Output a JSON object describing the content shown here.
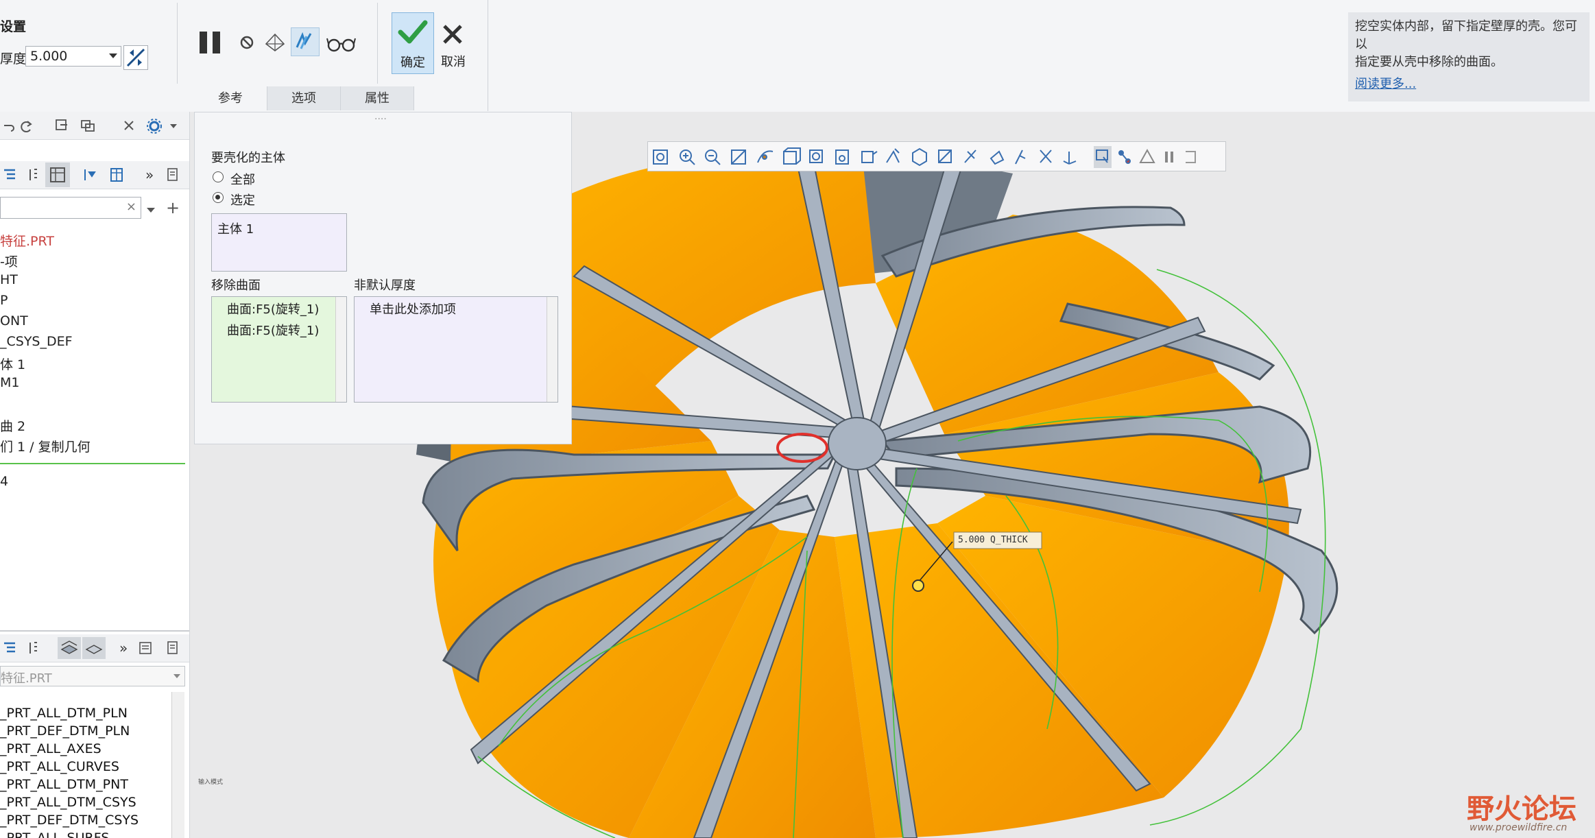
{
  "ribbon": {
    "group_title": "设置",
    "thickness_label": "厚度:",
    "thickness_value": "5.000",
    "ok_label": "确定",
    "cancel_label": "取消",
    "tabs": [
      "参考",
      "选项",
      "属性"
    ]
  },
  "help": {
    "text_line1": "挖空实体内部，留下指定壁厚的壳。您可以",
    "text_line2": "指定要从壳中移除的曲面。",
    "link": "阅读更多..."
  },
  "model_tree": {
    "items": [
      "特征.PRT",
      "-项",
      "HT",
      "P",
      "ONT",
      "_CSYS_DEF",
      "体 1",
      "M1",
      "",
      "曲 2",
      "们 1 / 复制几何",
      "",
      "4"
    ]
  },
  "layer_tree": {
    "dropdown": "特征.PRT",
    "items": [
      "_PRT_ALL_DTM_PLN",
      "_PRT_DEF_DTM_PLN",
      "_PRT_ALL_AXES",
      "_PRT_ALL_CURVES",
      "_PRT_ALL_DTM_PNT",
      "_PRT_ALL_DTM_CSYS",
      "_PRT_DEF_DTM_CSYS",
      "_PRT_ALL_SURFS"
    ]
  },
  "ref_panel": {
    "bodies_label": "要壳化的主体",
    "radio_all": "全部",
    "radio_selected": "选定",
    "bodies_list": [
      "主体 1"
    ],
    "remove_surfaces_label": "移除曲面",
    "remove_surfaces": [
      "曲面:F5(旋转_1)",
      "曲面:F5(旋转_1)"
    ],
    "non_default_label": "非默认厚度",
    "non_default_placeholder": "单击此处添加项"
  },
  "graphics": {
    "dimension_label": "5.000 Q_THICK",
    "corner_hint": "输入模式",
    "watermark_main": "野火论坛",
    "watermark_url": "www.proewildfire.cn"
  },
  "colors": {
    "orange": "#f5a300",
    "steel": "#9aa6b5",
    "accent": "#84b5dd"
  }
}
